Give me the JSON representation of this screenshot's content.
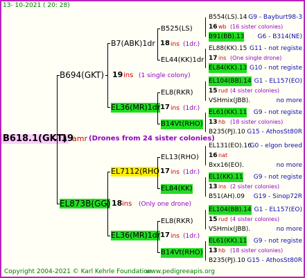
{
  "date_line": "13- 10-2021 ( 20: 28)",
  "footer": {
    "copyright": "Copyright 2004-2021 © Karl Kehrle Foundation",
    "site": "www.pedigreeapis.org"
  },
  "root": {
    "id": "B618.1(GKT)",
    "num": "19",
    "suffix": "amr",
    "note": "(Drones from 24 sister colonies)"
  },
  "g1_top": {
    "id": "B694(GKT)",
    "num": "19",
    "suffix": "ins",
    "note": "(1 single colony)"
  },
  "g1_bot": {
    "id": "EL873B(GG)",
    "num": "18",
    "suffix": "ins",
    "note": "(Only one drone)"
  },
  "g2": [
    {
      "id": "B7(ABK)1dr",
      "num": "18",
      "suffix": "ins",
      "note": "(1dr.)"
    },
    {
      "id": "EL36(MR)1dr",
      "num": "17",
      "suffix": "ins",
      "note": "(1dr.)"
    },
    {
      "id": "EL7112(RHO)",
      "num": "17",
      "suffix": "ins",
      "note": "(1dr.)"
    },
    {
      "id": "EL36(MR)1dr",
      "num": "17",
      "suffix": "ins",
      "note": "(1dr.)"
    }
  ],
  "g3": [
    {
      "id": "B525(LS)"
    },
    {
      "id": "EL44(KK)1dr"
    },
    {
      "id": "EL8(RKR)"
    },
    {
      "id": "B14Vt(RHO)"
    },
    {
      "id": "EL13(RHO)"
    },
    {
      "id": "EL84(KK)"
    },
    {
      "id": "EL8(RKR)"
    },
    {
      "id": "B14Vt(RHO)"
    }
  ],
  "g4": [
    {
      "line1": "B554(LS).14",
      "loc1": "G9 - Bayburt98-3",
      "num": "16",
      "suffix": "wb",
      "note": "(16 sister colonies)",
      "line3": "B91(BB).13",
      "loc3": "G6 - B314(NE)"
    },
    {
      "line1": "EL88(KK).15",
      "loc1": "G11 - not registe",
      "num": "17",
      "suffix": "ins",
      "note": "(One single drone)",
      "line3": "EL84(KK).13",
      "loc3": "G10 - not registe"
    },
    {
      "line1": "EL104(BB).14",
      "loc1": "G1 - EL157(EO)",
      "num": "15",
      "suffix": "rud",
      "note": "(4 sister colonies)",
      "line3": "VSHmix(JBB).",
      "loc3": "no more"
    },
    {
      "line1": "EL61(KK).11",
      "loc1": "G9 - not registe",
      "num": "13",
      "suffix": "hb",
      "note": "(18 sister colonies)",
      "line3": "B235(PJ).10",
      "loc3": "G15 - AthosSt80R"
    },
    {
      "line1": "EL131(EO).16",
      "loc1": "G0 - elgon breed",
      "num": "16",
      "suffix": "nat",
      "note": "",
      "line3": "Bxx16(EO).",
      "loc3": "no more"
    },
    {
      "line1": "EL1(KK).11",
      "loc1": "G9 - not registe",
      "num": "13",
      "suffix": "ins",
      "note": "(2 sister colonies)",
      "line3": "B51(AH).09",
      "loc3": "G19 - Sinop72R"
    },
    {
      "line1": "EL104(BB).14",
      "loc1": "G1 - EL157(EO)",
      "num": "15",
      "suffix": "rud",
      "note": "(4 sister colonies)",
      "line3": "VSHmix(JBB).",
      "loc3": "no more"
    },
    {
      "line1": "EL61(KK).11",
      "loc1": "G9 - not registe",
      "num": "13",
      "suffix": "hb",
      "note": "(18 sister colonies)",
      "line3": "B235(PJ).10",
      "loc3": "G15 - AthosSt80R"
    }
  ]
}
